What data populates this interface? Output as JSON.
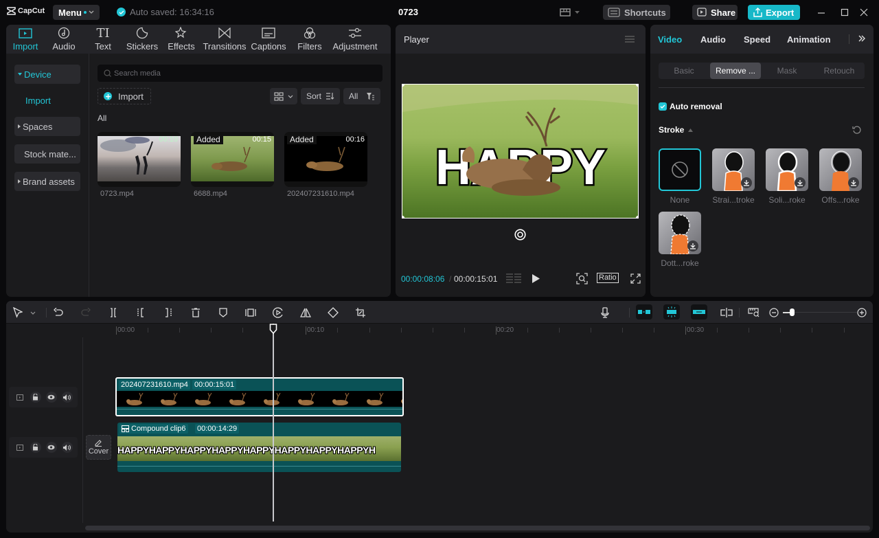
{
  "titlebar": {
    "app_name": "CapCut",
    "menu_label": "Menu",
    "autosave_text": "Auto saved: 16:34:16",
    "project_title": "0723",
    "shortcuts_label": "Shortcuts",
    "share_label": "Share",
    "export_label": "Export"
  },
  "media": {
    "tabs": [
      {
        "label": "Import",
        "icon": "import-icon",
        "active": true
      },
      {
        "label": "Audio",
        "icon": "music-note-icon"
      },
      {
        "label": "Text",
        "icon": "text-icon"
      },
      {
        "label": "Stickers",
        "icon": "sticker-icon"
      },
      {
        "label": "Effects",
        "icon": "star-sparkle-icon"
      },
      {
        "label": "Transitions",
        "icon": "bowtie-icon"
      },
      {
        "label": "Captions",
        "icon": "captions-icon"
      },
      {
        "label": "Filters",
        "icon": "filters-icon"
      },
      {
        "label": "Adjustment",
        "icon": "sliders-icon"
      }
    ],
    "sidebar": {
      "device": "Device",
      "import": "Import",
      "spaces": "Spaces",
      "stock": "Stock mate...",
      "brand": "Brand assets"
    },
    "search_placeholder": "Search media",
    "import_label": "Import",
    "sort_label": "Sort",
    "filter_label": "All",
    "section_label": "All",
    "items": [
      {
        "name": "0723.mp4",
        "duration": "00:10",
        "badge": ""
      },
      {
        "name": "6688.mp4",
        "duration": "00:15",
        "badge": "Added"
      },
      {
        "name": "202407231610.mp4",
        "duration": "00:16",
        "badge": "Added"
      }
    ]
  },
  "player": {
    "title": "Player",
    "overlay_text": "HAPPY",
    "current_time": "00:00:08:06",
    "separator": "/",
    "total_time": "00:00:15:01",
    "ratio_label": "Ratio"
  },
  "props": {
    "tabs": [
      "Video",
      "Audio",
      "Speed",
      "Animation"
    ],
    "active_tab": "Video",
    "subtabs": [
      "Basic",
      "Remove ...",
      "Mask",
      "Retouch"
    ],
    "active_subtab": "Remove ...",
    "auto_removal_label": "Auto removal",
    "auto_removal_checked": true,
    "stroke_label": "Stroke",
    "stroke_options": [
      {
        "label": "None",
        "selected": true
      },
      {
        "label": "Strai...troke"
      },
      {
        "label": "Soli...roke"
      },
      {
        "label": "Offs...roke"
      },
      {
        "label": "Dott...roke"
      }
    ]
  },
  "timeline": {
    "ruler": [
      "00:00",
      "00:10",
      "00:20",
      "00:30"
    ],
    "tracks": [
      {
        "clip_name": "202407231610.mp4",
        "clip_duration": "00:00:15:01"
      },
      {
        "clip_name": "Compound clip6",
        "clip_duration": "00:00:14:29",
        "overlay_text": "HAPPYHAPPYHAPPYHAPPYHAPPYHAPPYHAPPYHAPPYH"
      }
    ],
    "cover_label": "Cover"
  },
  "colors": {
    "accent": "#22c6d6",
    "export": "#17b8c8",
    "clip": "#0a5256",
    "panel": "#1b1b1d",
    "header": "#242428"
  }
}
